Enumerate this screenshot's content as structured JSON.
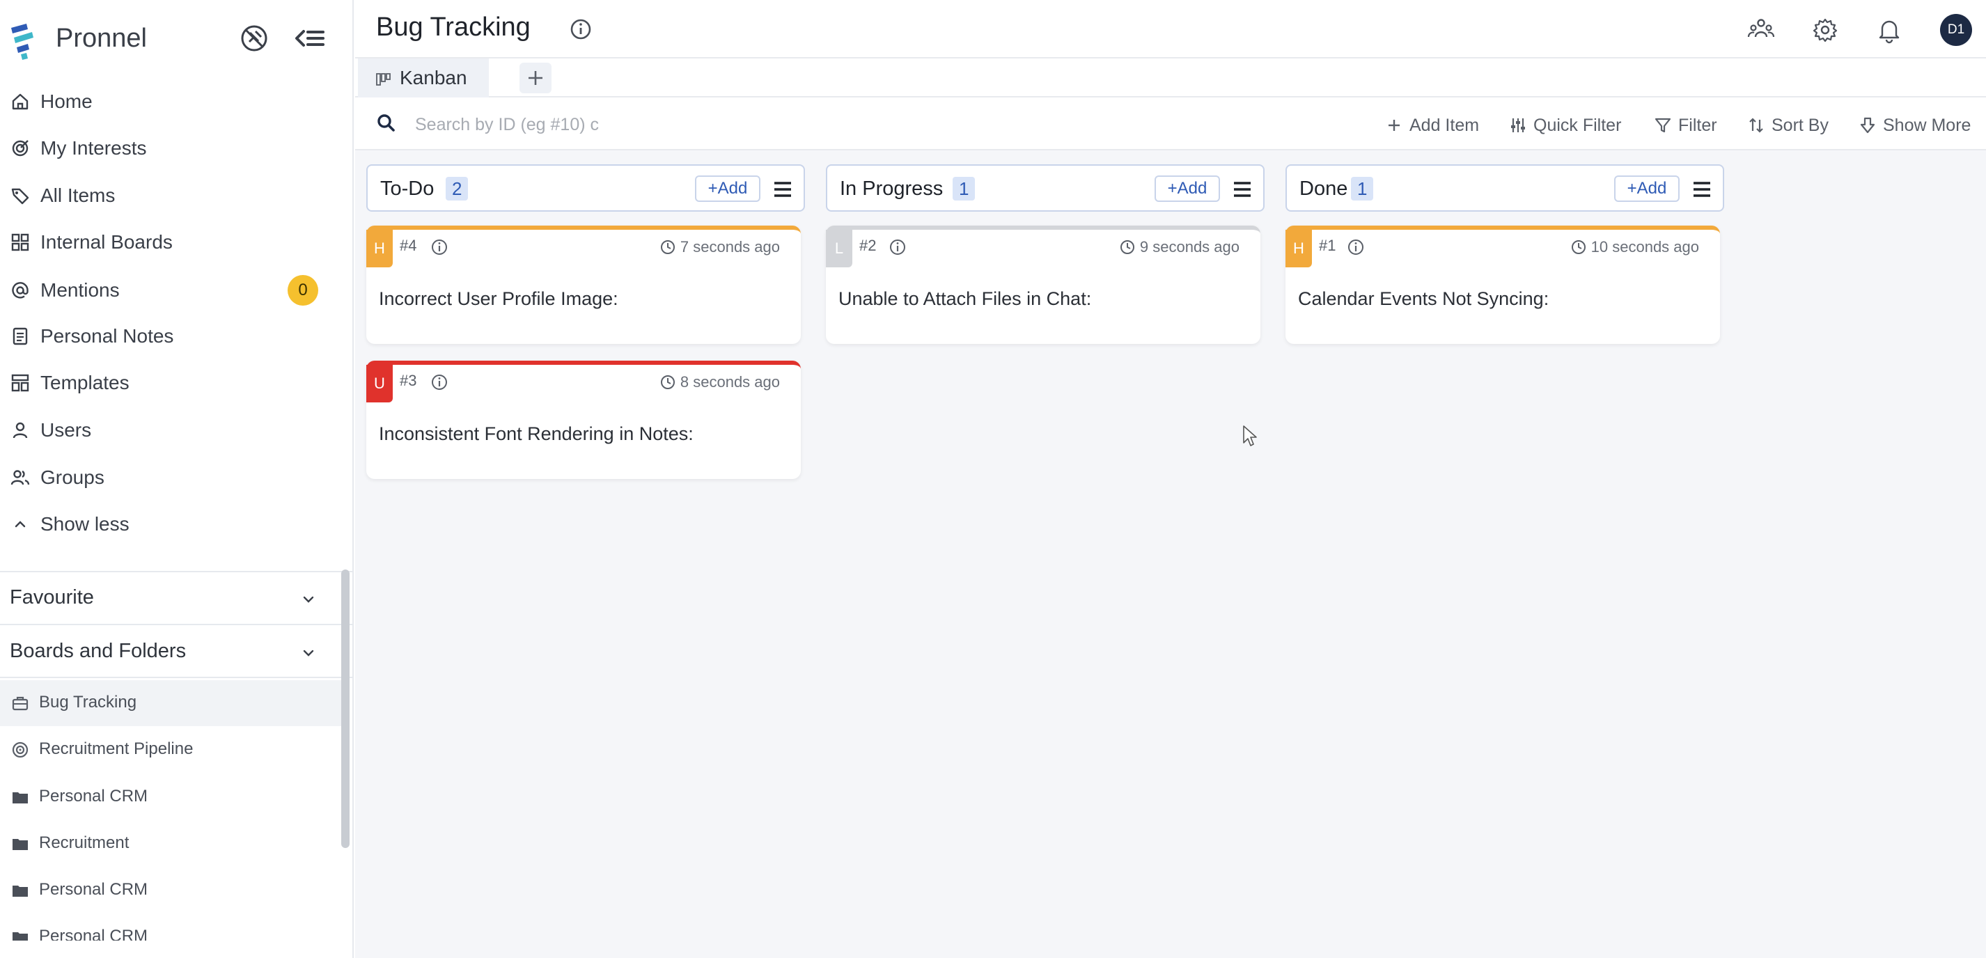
{
  "brand": {
    "name": "Pronnel"
  },
  "sidebar": {
    "nav": [
      {
        "label": "Home",
        "icon": "home-icon"
      },
      {
        "label": "My Interests",
        "icon": "interests-icon"
      },
      {
        "label": "All Items",
        "icon": "tag-icon"
      },
      {
        "label": "Internal Boards",
        "icon": "grid-icon"
      },
      {
        "label": "Mentions",
        "icon": "at-icon",
        "badge": "0"
      },
      {
        "label": "Personal Notes",
        "icon": "note-icon"
      },
      {
        "label": "Templates",
        "icon": "template-icon"
      },
      {
        "label": "Users",
        "icon": "user-icon"
      },
      {
        "label": "Groups",
        "icon": "users-icon"
      },
      {
        "label": "Show less",
        "icon": "chevron-up-icon"
      }
    ],
    "favourite": "Favourite",
    "boards_section": "Boards and Folders",
    "boards": [
      {
        "label": "Bug Tracking",
        "icon": "briefcase-icon"
      },
      {
        "label": "Recruitment Pipeline",
        "icon": "target-icon"
      },
      {
        "label": "Personal CRM",
        "icon": "folder-icon"
      },
      {
        "label": "Recruitment",
        "icon": "folder-icon"
      },
      {
        "label": "Personal CRM",
        "icon": "folder-icon"
      },
      {
        "label": "Personal CRM",
        "icon": "folder-icon"
      }
    ]
  },
  "header": {
    "title": "Bug Tracking",
    "avatar": "D1"
  },
  "tabs": [
    {
      "label": "Kanban"
    }
  ],
  "toolbar": {
    "search_placeholder": "Search by ID (eg #10) c",
    "add_item": "Add Item",
    "quick_filter": "Quick Filter",
    "filter": "Filter",
    "sort_by": "Sort By",
    "show_more": "Show More"
  },
  "columns": [
    {
      "title": "To-Do",
      "count": "2",
      "add": "+Add",
      "cards": [
        {
          "priority": "H",
          "priority_color": "#f2a93b",
          "id": "#4",
          "time": "7 seconds ago",
          "title": "Incorrect User Profile Image:"
        },
        {
          "priority": "U",
          "priority_color": "#e0322c",
          "id": "#3",
          "time": "8 seconds ago",
          "title": "Inconsistent Font Rendering in Notes:"
        }
      ]
    },
    {
      "title": "In Progress",
      "count": "1",
      "add": "+Add",
      "cards": [
        {
          "priority": "L",
          "priority_color": "#d3d5d9",
          "id": "#2",
          "time": "9 seconds ago",
          "title": "Unable to Attach Files in Chat:"
        }
      ]
    },
    {
      "title": "Done",
      "count": "1",
      "add": "+Add",
      "cards": [
        {
          "priority": "H",
          "priority_color": "#f2a93b",
          "id": "#1",
          "time": "10 seconds ago",
          "title": "Calendar Events Not Syncing:"
        }
      ]
    }
  ],
  "colors": {
    "accent": "#2f5bb5",
    "high": "#f2a93b",
    "urgent": "#e0322c",
    "low": "#d3d5d9",
    "badge": "#f5c02e"
  }
}
